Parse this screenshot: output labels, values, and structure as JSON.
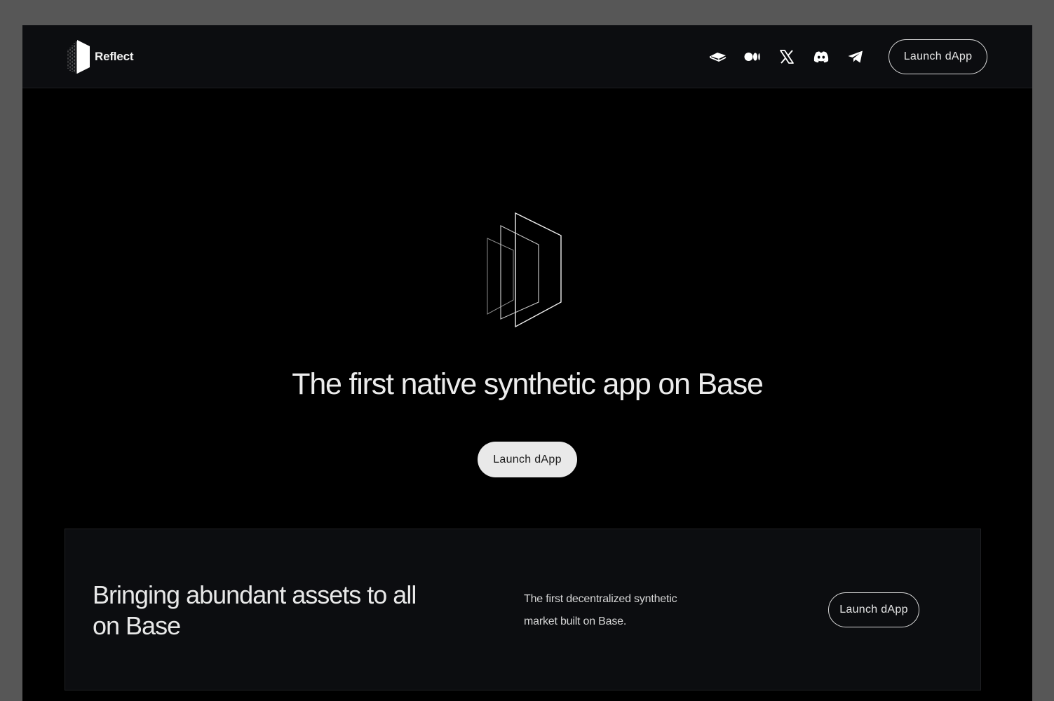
{
  "navbar": {
    "brand_name": "Reflect",
    "social_links": [
      {
        "icon": "gitbook-icon"
      },
      {
        "icon": "medium-icon"
      },
      {
        "icon": "x-icon"
      },
      {
        "icon": "discord-icon"
      },
      {
        "icon": "telegram-icon"
      }
    ],
    "cta_label": "Launch dApp"
  },
  "hero": {
    "title": "The first native synthetic app on Base",
    "cta_label": "Launch dApp"
  },
  "feature": {
    "heading": "Bringing abundant assets to all on Base",
    "description": "The first decentralized synthetic market built on Base.",
    "cta_label": "Launch dApp"
  },
  "colors": {
    "page_background": "#000000",
    "nav_background": "#0c0d10",
    "card_background": "#0c0d10",
    "text_primary": "#ececec",
    "hero_button_fill": "#e9e9e9"
  }
}
